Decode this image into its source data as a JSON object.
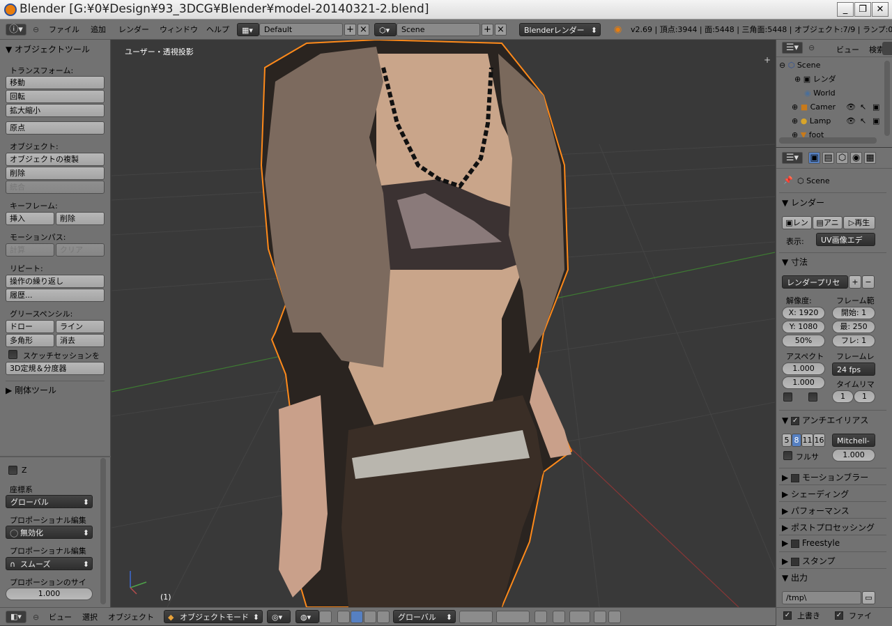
{
  "titlebar": {
    "title": "Blender [G:¥0¥Design¥93_3DCG¥Blender¥model-20140321-2.blend]"
  },
  "info": {
    "menus": [
      "ファイル",
      "追加",
      "レンダー",
      "ウィンドウ",
      "ヘルプ"
    ],
    "screen_layout": "Default",
    "scene": "Scene",
    "render_engine": "Blenderレンダー",
    "stats": "v2.69 | 頂点:3944 | 面:5448 | 三角面:5448 | オブジェクト:7/9 | ランプ:0/1"
  },
  "toolshelf": {
    "title": "▼ オブジェクトツール",
    "transform_label": "トランスフォーム:",
    "move": "移動",
    "rotate": "回転",
    "scale": "拡大縮小",
    "origin": "原点",
    "object_label": "オブジェクト:",
    "duplicate": "オブジェクトの複製",
    "delete": "削除",
    "join": "統合",
    "keyframe_label": "キーフレーム:",
    "insert": "挿入",
    "kf_delete": "削除",
    "motion_label": "モーションパス:",
    "calculate": "計算",
    "clear": "クリア",
    "repeat_label": "リピート:",
    "repeat_last": "操作の繰り返し",
    "history": "履歴...",
    "grease_label": "グリースペンシル:",
    "draw": "ドロー",
    "line": "ライン",
    "poly": "多角形",
    "erase": "消去",
    "sketch": "スケッチセッションを",
    "ruler": "3D定規＆分度器",
    "rigid": "▶ 剛体ツール",
    "op_z": "Z",
    "coord_label": "座標系",
    "coord_value": "グローバル",
    "prop_edit_label": "プロポーショナル編集",
    "prop_edit_value": "無効化",
    "prop_falloff_label": "プロポーショナル編集",
    "prop_falloff_value": "スムーズ",
    "prop_size_label": "プロポーションのサイ",
    "prop_size_value": "1.000"
  },
  "viewport": {
    "label": "ユーザー・透視投影",
    "frame": "(1)"
  },
  "outliner": {
    "view": "ビュー",
    "search": "検索",
    "rows": [
      "Scene",
      "レンダ",
      "World",
      "Camer",
      "Lamp",
      "foot"
    ]
  },
  "properties": {
    "context": "Scene",
    "render_header": "▼ レンダー",
    "render_btn": "レン",
    "anim_btn": "アニ",
    "play_btn": "再生",
    "display_label": "表示:",
    "display_value": "UV画像エデ",
    "dimensions_header": "▼ 寸法",
    "preset": "レンダープリセ",
    "resolution_label": "解像度:",
    "frame_range_label": "フレーム範",
    "res_x": "X: 1920",
    "res_y": "Y: 1080",
    "res_pct": "50%",
    "start": "開始: 1",
    "end": "最: 250",
    "step": "フレ: 1",
    "aspect_label": "アスペクト",
    "framerate_label": "フレームレ",
    "aspect_x": "1.000",
    "aspect_y": "1.000",
    "fps": "24 fps",
    "timeremap_label": "タイムリマ",
    "remap_old": "1",
    "remap_new": "1",
    "aa_header": "アンチエイリアス",
    "aa_samples": [
      "5",
      "8",
      "11",
      "16"
    ],
    "aa_active": "8",
    "aa_filter": "Mitchell-",
    "full_sample": "フルサ",
    "aa_size": "1.000",
    "motion_blur": "モーションブラー",
    "shading": "▶ シェーディング",
    "performance": "▶ パフォーマンス",
    "post": "▶ ポストプロセッシング",
    "freestyle": "Freestyle",
    "stamp": "スタンプ",
    "output_header": "▼ 出力",
    "output_path": "/tmp\\",
    "overwrite": "上書き",
    "file_ext": "ファイ"
  },
  "bottombar": {
    "view": "ビュー",
    "select": "選択",
    "object": "オブジェクト",
    "mode": "オブジェクトモード",
    "orientation": "グローバル"
  },
  "colors": {
    "accent": "#5680c2",
    "panel": "#727272",
    "viewport": "#393939",
    "selection": "#f08a24"
  }
}
